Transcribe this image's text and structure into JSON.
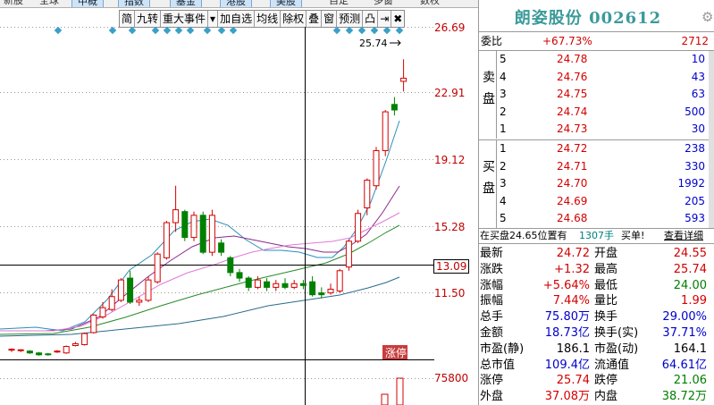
{
  "tabs": [
    "新股",
    "全球",
    "中概",
    "指数",
    "基金",
    "港股",
    "美股",
    "自定",
    "多窗",
    "数权"
  ],
  "toolbar": [
    "简",
    "九转",
    "重大事件",
    "▾",
    "加自选",
    "均线",
    "除权",
    "叠",
    "窗",
    "预测",
    "凸",
    "⇥",
    "✖"
  ],
  "axis": {
    "price_labels": [
      "26.69",
      "22.91",
      "19.12",
      "15.28",
      "13.09",
      "11.50"
    ],
    "volume_label": "75800",
    "high_marker": "25.74",
    "zhangting_badge": "涨停"
  },
  "colors": {
    "up": "#d40000",
    "down": "#008000",
    "title": "#3b9a9a"
  },
  "chart_data": {
    "type": "candlestick",
    "ylim": [
      9.5,
      27.5
    ],
    "candles": [
      {
        "o": 10.02,
        "c": 10.05,
        "h": 10.1,
        "l": 9.9
      },
      {
        "o": 10.0,
        "c": 10.02,
        "h": 10.05,
        "l": 9.9
      },
      {
        "o": 9.95,
        "c": 9.85,
        "h": 10.0,
        "l": 9.8
      },
      {
        "o": 9.85,
        "c": 9.75,
        "h": 9.9,
        "l": 9.7
      },
      {
        "o": 9.8,
        "c": 9.78,
        "h": 9.85,
        "l": 9.7
      },
      {
        "o": 9.9,
        "c": 9.95,
        "h": 10.0,
        "l": 9.85
      },
      {
        "o": 9.85,
        "c": 10.2,
        "h": 10.25,
        "l": 9.8
      },
      {
        "o": 10.25,
        "c": 10.35,
        "h": 10.45,
        "l": 10.2
      },
      {
        "o": 10.3,
        "c": 10.9,
        "h": 10.95,
        "l": 10.25
      },
      {
        "o": 10.95,
        "c": 11.9,
        "h": 11.95,
        "l": 10.9
      },
      {
        "o": 11.8,
        "c": 12.3,
        "h": 12.6,
        "l": 11.7
      },
      {
        "o": 12.2,
        "c": 12.9,
        "h": 13.3,
        "l": 12.1
      },
      {
        "o": 12.7,
        "c": 13.8,
        "h": 13.9,
        "l": 12.6
      },
      {
        "o": 13.9,
        "c": 12.6,
        "h": 14.3,
        "l": 12.5
      },
      {
        "o": 12.6,
        "c": 12.7,
        "h": 12.9,
        "l": 12.4
      },
      {
        "o": 12.7,
        "c": 13.8,
        "h": 14.0,
        "l": 12.6
      },
      {
        "o": 13.7,
        "c": 15.2,
        "h": 15.3,
        "l": 13.6
      },
      {
        "o": 15.0,
        "c": 16.9,
        "h": 17.0,
        "l": 14.9
      },
      {
        "o": 16.9,
        "c": 17.6,
        "h": 18.9,
        "l": 16.4
      },
      {
        "o": 17.5,
        "c": 16.1,
        "h": 17.6,
        "l": 15.9
      },
      {
        "o": 16.1,
        "c": 17.3,
        "h": 17.5,
        "l": 15.9
      },
      {
        "o": 17.3,
        "c": 15.3,
        "h": 17.5,
        "l": 15.2
      },
      {
        "o": 15.3,
        "c": 17.3,
        "h": 17.6,
        "l": 15.1
      },
      {
        "o": 15.8,
        "c": 15.3,
        "h": 16.0,
        "l": 15.1
      },
      {
        "o": 15.0,
        "c": 14.2,
        "h": 15.1,
        "l": 14.0
      },
      {
        "o": 14.2,
        "c": 13.9,
        "h": 14.4,
        "l": 13.7
      },
      {
        "o": 13.9,
        "c": 13.4,
        "h": 14.0,
        "l": 13.2
      },
      {
        "o": 13.4,
        "c": 13.8,
        "h": 14.0,
        "l": 13.3
      },
      {
        "o": 13.7,
        "c": 13.4,
        "h": 13.9,
        "l": 13.2
      },
      {
        "o": 13.4,
        "c": 13.6,
        "h": 13.8,
        "l": 13.2
      },
      {
        "o": 13.6,
        "c": 13.4,
        "h": 13.9,
        "l": 13.3
      },
      {
        "o": 13.4,
        "c": 13.6,
        "h": 13.8,
        "l": 13.3
      },
      {
        "o": 13.6,
        "c": 13.5,
        "h": 13.8,
        "l": 13.3
      },
      {
        "o": 13.7,
        "c": 13.0,
        "h": 14.0,
        "l": 12.9
      },
      {
        "o": 13.1,
        "c": 13.0,
        "h": 13.4,
        "l": 12.8
      },
      {
        "o": 13.1,
        "c": 13.3,
        "h": 13.6,
        "l": 13.0
      },
      {
        "o": 13.2,
        "c": 14.3,
        "h": 14.4,
        "l": 13.1
      },
      {
        "o": 14.5,
        "c": 15.9,
        "h": 16.0,
        "l": 14.3
      },
      {
        "o": 15.9,
        "c": 17.4,
        "h": 17.6,
        "l": 15.8
      },
      {
        "o": 17.7,
        "c": 19.2,
        "h": 19.3,
        "l": 17.3
      },
      {
        "o": 18.9,
        "c": 20.8,
        "h": 21.0,
        "l": 18.7
      },
      {
        "o": 20.8,
        "c": 22.9,
        "h": 23.0,
        "l": 20.5
      },
      {
        "o": 23.3,
        "c": 23.0,
        "h": 23.7,
        "l": 22.7
      },
      {
        "o": 24.55,
        "c": 24.72,
        "h": 25.74,
        "l": 24.0
      }
    ]
  },
  "quote": {
    "name": "朗姿股份",
    "code": "002612",
    "weibi_label": "委比",
    "weibi_value": "+67.73%",
    "weibi_diff": "2712",
    "sell_label": [
      "卖",
      "盘"
    ],
    "buy_label": [
      "买",
      "盘"
    ],
    "asks": [
      {
        "level": "5",
        "price": "24.78",
        "vol": "10"
      },
      {
        "level": "4",
        "price": "24.76",
        "vol": "43"
      },
      {
        "level": "3",
        "price": "24.75",
        "vol": "63"
      },
      {
        "level": "2",
        "price": "24.74",
        "vol": "500"
      },
      {
        "level": "1",
        "price": "24.73",
        "vol": "30"
      }
    ],
    "bids": [
      {
        "level": "1",
        "price": "24.72",
        "vol": "238"
      },
      {
        "level": "2",
        "price": "24.71",
        "vol": "330"
      },
      {
        "level": "3",
        "price": "24.70",
        "vol": "1992"
      },
      {
        "level": "4",
        "price": "24.69",
        "vol": "205"
      },
      {
        "level": "5",
        "price": "24.68",
        "vol": "593"
      }
    ],
    "notice_text": "在买盘24.65位置有",
    "notice_vol": "1307手",
    "notice_tail": "买单!",
    "notice_link": "查看详细",
    "stats": [
      [
        "最新",
        "24.72",
        "开盘",
        "24.55"
      ],
      [
        "涨跌",
        "+1.32",
        "最高",
        "25.74"
      ],
      [
        "涨幅",
        "+5.64%",
        "最低",
        "24.00"
      ],
      [
        "振幅",
        "7.44%",
        "量比",
        "1.99"
      ],
      [
        "总手",
        "75.80万",
        "换手",
        "29.00%"
      ],
      [
        "金额",
        "18.73亿",
        "换手(实)",
        "37.71%"
      ],
      [
        "市盈(静)",
        "186.1",
        "市盈(动)",
        "164.1"
      ],
      [
        "总市值",
        "109.4亿",
        "流通值",
        "64.61亿"
      ],
      [
        "涨停",
        "25.74",
        "跌停",
        "21.06"
      ],
      [
        "外盘",
        "37.08万",
        "内盘",
        "38.72万"
      ]
    ]
  }
}
